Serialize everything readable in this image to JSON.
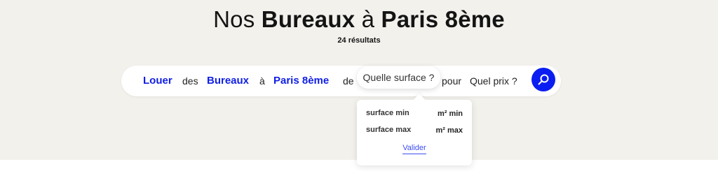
{
  "header": {
    "title_prefix": "Nos ",
    "title_property": "Bureaux",
    "title_middle": " à ",
    "title_location": "Paris 8ème",
    "results_count": "24 résultats"
  },
  "search": {
    "action": "Louer",
    "word_des": "des",
    "property": "Bureaux",
    "word_a": "à",
    "location": "Paris 8ème",
    "word_de": "de",
    "surface_pill": "Quelle surface ?",
    "word_pour": "pour",
    "price": "Quel prix ?",
    "search_icon": "search-icon"
  },
  "surface_dropdown": {
    "min_label": "surface min",
    "min_placeholder": "m² min",
    "max_label": "surface max",
    "max_placeholder": "m² max",
    "validate": "Valider"
  },
  "colors": {
    "accent": "#0a1ef2",
    "link": "#0f1ee6",
    "hero_bg": "#f3f1ec"
  }
}
